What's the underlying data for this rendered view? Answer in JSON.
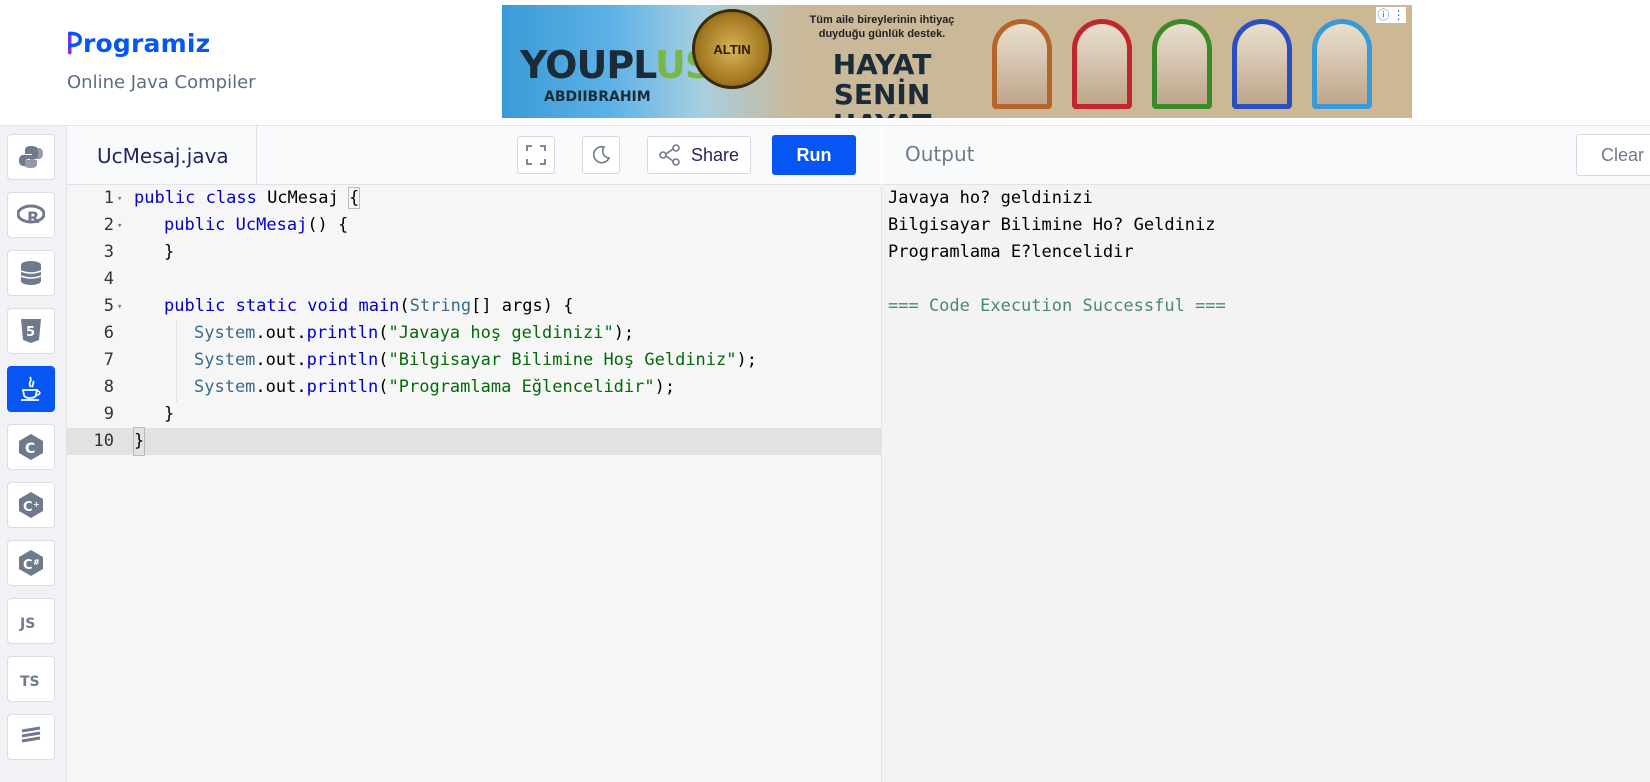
{
  "header": {
    "logo_text": "rogramiz",
    "logo_letter": "P",
    "subtitle": "Online Java Compiler"
  },
  "ad": {
    "brand_a": "YOUPL",
    "brand_b": "US",
    "company": "ABDIIBRAHIM",
    "seal": "ALTIN",
    "tagline": "Tüm aile bireylerinin ihtiyaç duyduğu günlük destek.",
    "headline_1": "HAYAT SENİN",
    "headline_2": "HAYAT SENSİN",
    "info": "ⓘ ⋮"
  },
  "sidebar": {
    "items": [
      {
        "name": "python",
        "label": "Py"
      },
      {
        "name": "r",
        "label": "R"
      },
      {
        "name": "sql",
        "label": "≣"
      },
      {
        "name": "html",
        "label": "5"
      },
      {
        "name": "java",
        "label": "☕"
      },
      {
        "name": "c",
        "label": "C"
      },
      {
        "name": "cpp",
        "label": "C"
      },
      {
        "name": "csharp",
        "label": "C"
      },
      {
        "name": "js",
        "label": "JS"
      },
      {
        "name": "ts",
        "label": "TS"
      },
      {
        "name": "more",
        "label": "≡"
      }
    ]
  },
  "editor": {
    "file_name": "UcMesaj.java",
    "run_label": "Run",
    "share_label": "Share",
    "lines": [
      "1",
      "2",
      "3",
      "4",
      "5",
      "6",
      "7",
      "8",
      "9",
      "10"
    ],
    "code": {
      "l1_kw": "public class",
      "l1_name": " UcMesaj ",
      "l1_brace": "{",
      "l2_kw": "public",
      "l2_name": " UcMesaj",
      "l2_rest": "() {",
      "l3": "}",
      "l5_kw": "public static void",
      "l5_fn": " main",
      "l5_p1": "(",
      "l5_type": "String",
      "l5_rest": "[] args) {",
      "println_obj": "System",
      "println_mid": ".out.",
      "println_fn": "println",
      "open": "(",
      "close": ");",
      "s1": "\"Javaya hoş geldinizi\"",
      "s2": "\"Bilgisayar Bilimine Hoş Geldiniz\"",
      "s3": "\"Programlama Eğlencelidir\"",
      "l9": "}",
      "l10": "}"
    }
  },
  "output": {
    "title": "Output",
    "clear_label": "Clear",
    "lines": [
      "Javaya ho? geldinizi",
      "Bilgisayar Bilimine Ho? Geldiniz",
      "Programlama E?lencelidir",
      "",
      "=== Code Execution Successful ==="
    ]
  },
  "colors": {
    "accent": "#0556f3",
    "keyword": "#0000c8",
    "string": "#036a07",
    "success": "#4a8a6a"
  }
}
